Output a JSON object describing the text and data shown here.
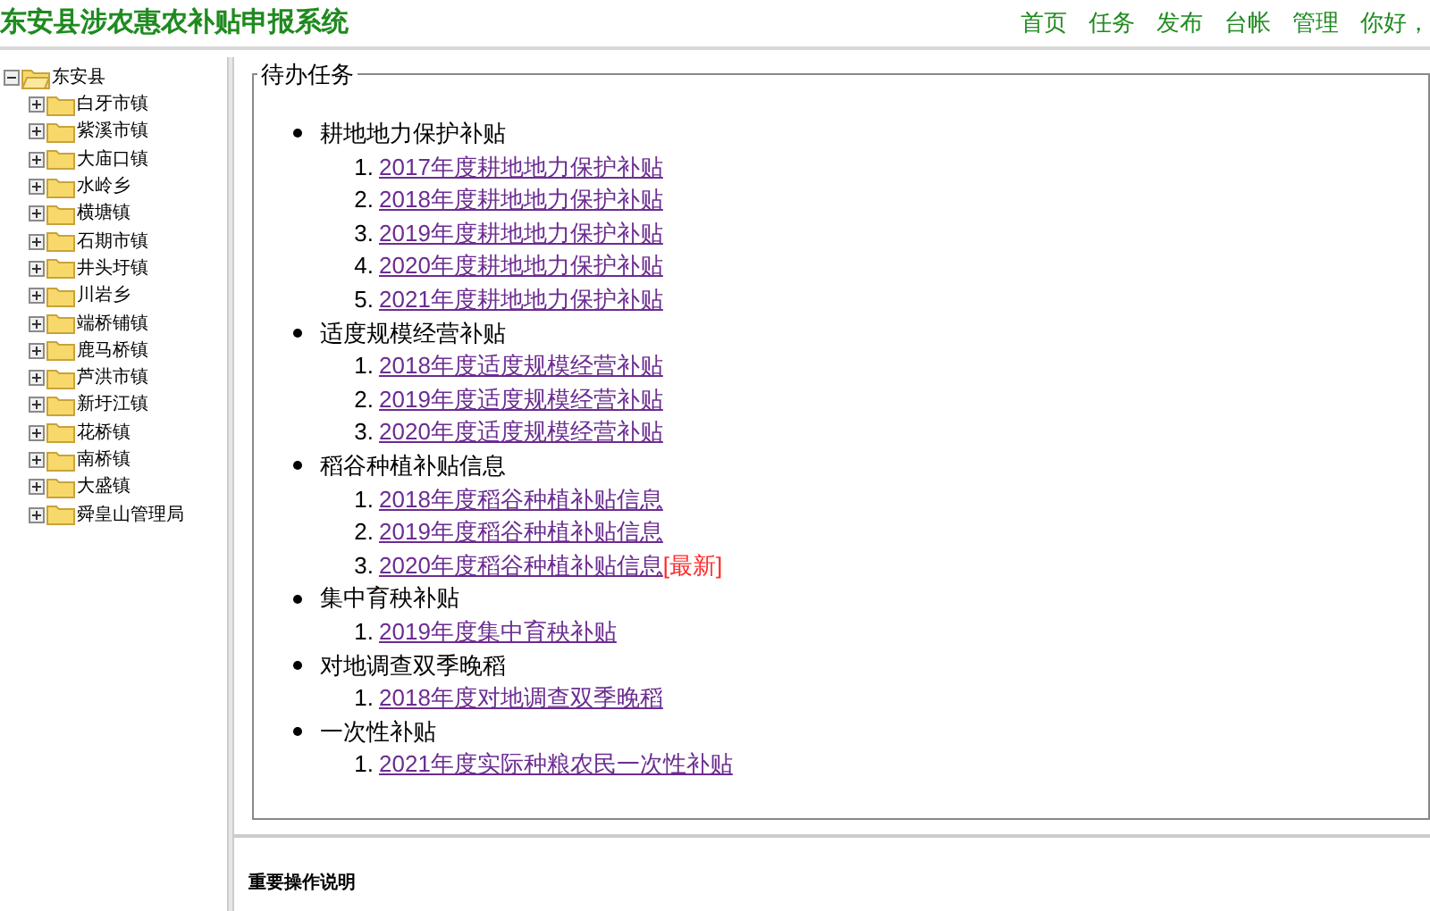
{
  "header": {
    "title": "东安县涉农惠农补贴申报系统",
    "nav": [
      "首页",
      "任务",
      "发布",
      "台帐",
      "管理",
      "你好，"
    ]
  },
  "tree": {
    "label": "东安县",
    "expanded": true,
    "children": [
      {
        "label": "白牙市镇",
        "expanded": false
      },
      {
        "label": "紫溪市镇",
        "expanded": false
      },
      {
        "label": "大庙口镇",
        "expanded": false
      },
      {
        "label": "水岭乡",
        "expanded": false
      },
      {
        "label": "横塘镇",
        "expanded": false
      },
      {
        "label": "石期市镇",
        "expanded": false
      },
      {
        "label": "井头圩镇",
        "expanded": false
      },
      {
        "label": "川岩乡",
        "expanded": false
      },
      {
        "label": "端桥铺镇",
        "expanded": false
      },
      {
        "label": "鹿马桥镇",
        "expanded": false
      },
      {
        "label": "芦洪市镇",
        "expanded": false
      },
      {
        "label": "新圩江镇",
        "expanded": false
      },
      {
        "label": "花桥镇",
        "expanded": false
      },
      {
        "label": "南桥镇",
        "expanded": false
      },
      {
        "label": "大盛镇",
        "expanded": false
      },
      {
        "label": "舜皇山管理局",
        "expanded": false
      }
    ]
  },
  "tasks": {
    "legend": "待办任务",
    "groups": [
      {
        "title": "耕地地力保护补贴",
        "items": [
          {
            "number": "1.",
            "label": "2017年度耕地地力保护补贴"
          },
          {
            "number": "2.",
            "label": "2018年度耕地地力保护补贴"
          },
          {
            "number": "3.",
            "label": "2019年度耕地地力保护补贴"
          },
          {
            "number": "4.",
            "label": "2020年度耕地地力保护补贴"
          },
          {
            "number": "5.",
            "label": "2021年度耕地地力保护补贴"
          }
        ]
      },
      {
        "title": "适度规模经营补贴",
        "items": [
          {
            "number": "1.",
            "label": "2018年度适度规模经营补贴"
          },
          {
            "number": "2.",
            "label": "2019年度适度规模经营补贴"
          },
          {
            "number": "3.",
            "label": "2020年度适度规模经营补贴"
          }
        ]
      },
      {
        "title": "稻谷种植补贴信息",
        "items": [
          {
            "number": "1.",
            "label": "2018年度稻谷种植补贴信息"
          },
          {
            "number": "2.",
            "label": "2019年度稻谷种植补贴信息"
          },
          {
            "number": "3.",
            "label": "2020年度稻谷种植补贴信息",
            "badge": "[最新]"
          }
        ]
      },
      {
        "title": "集中育秧补贴",
        "items": [
          {
            "number": "1.",
            "label": "2019年度集中育秧补贴"
          }
        ]
      },
      {
        "title": "对地调查双季晚稻",
        "items": [
          {
            "number": "1.",
            "label": "2018年度对地调查双季晚稻"
          }
        ]
      },
      {
        "title": "一次性补贴",
        "items": [
          {
            "number": "1.",
            "label": "2021年度实际种粮农民一次性补贴"
          }
        ]
      }
    ]
  },
  "notes": {
    "title": "重要操作说明"
  }
}
